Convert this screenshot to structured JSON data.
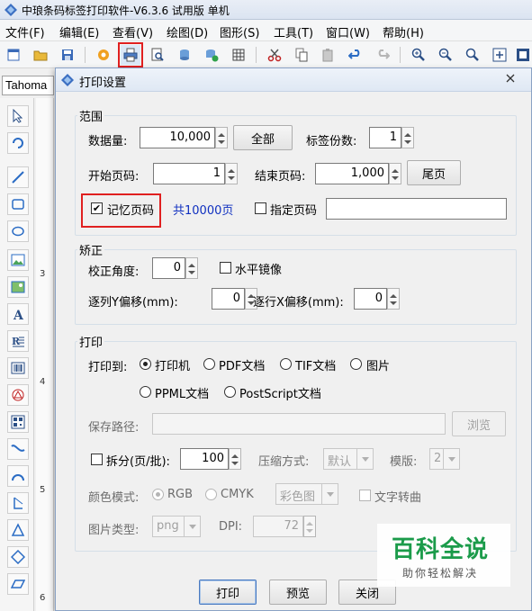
{
  "app": {
    "title": "中琅条码标签打印软件-V6.3.6 试用版 单机"
  },
  "menu": [
    {
      "label": "文件(F)"
    },
    {
      "label": "编辑(E)"
    },
    {
      "label": "查看(V)"
    },
    {
      "label": "绘图(D)"
    },
    {
      "label": "图形(S)"
    },
    {
      "label": "工具(T)"
    },
    {
      "label": "窗口(W)"
    },
    {
      "label": "帮助(H)"
    }
  ],
  "toolbar": {
    "font_value": "Tahoma",
    "highlighted_icon": "printer-icon"
  },
  "ruler": {
    "numbers": [
      "3",
      "4",
      "5",
      "6"
    ]
  },
  "dialog": {
    "title": "打印设置",
    "range": {
      "group_title": "范围",
      "data_count_label": "数据量:",
      "data_count_value": "10,000",
      "all_button": "全部",
      "copies_label": "标签份数:",
      "copies_value": "1",
      "start_page_label": "开始页码:",
      "start_page_value": "1",
      "end_page_label": "结束页码:",
      "end_page_value": "1,000",
      "last_page_button": "尾页",
      "remember_page_label": "记忆页码",
      "remember_page_checked": true,
      "total_pages_text": "共10000页",
      "specify_page_label": "指定页码",
      "specify_page_checked": false,
      "specify_page_value": ""
    },
    "correction": {
      "group_title": "矫正",
      "angle_label": "校正角度:",
      "angle_value": "0",
      "mirror_label": "水平镜像",
      "mirror_checked": false,
      "y_offset_label": "逐列Y偏移(mm):",
      "y_offset_value": "0",
      "x_offset_label": "逐行X偏移(mm):",
      "x_offset_value": "0"
    },
    "print": {
      "group_title": "打印",
      "print_to_label": "打印到:",
      "targets": [
        {
          "label": "打印机",
          "checked": true
        },
        {
          "label": "PDF文档",
          "checked": false
        },
        {
          "label": "TIF文档",
          "checked": false
        },
        {
          "label": "图片",
          "checked": false
        },
        {
          "label": "PPML文档",
          "checked": false
        },
        {
          "label": "PostScript文档",
          "checked": false
        }
      ],
      "save_path_label": "保存路径:",
      "save_path_value": "",
      "browse_button": "浏览",
      "split_label": "拆分(页/批):",
      "split_checked": false,
      "split_value": "100",
      "compress_label": "压缩方式:",
      "compress_value": "默认",
      "template_label": "模版:",
      "template_value": "2",
      "color_mode_label": "颜色模式:",
      "rgb_label": "RGB",
      "cmyk_label": "CMYK",
      "color_value": "彩色图",
      "text_to_curve_label": "文字转曲",
      "image_type_label": "图片类型:",
      "image_type_value": "png",
      "dpi_label": "DPI:",
      "dpi_value": "72"
    },
    "buttons": {
      "print": "打印",
      "preview": "预览",
      "close": "关闭"
    }
  },
  "watermark": {
    "main": "百科全说",
    "sub": "助你轻松解决"
  },
  "colors": {
    "highlight_red": "#e02020",
    "link_blue": "#1030c0",
    "watermark_green": "#1b9b4a"
  }
}
